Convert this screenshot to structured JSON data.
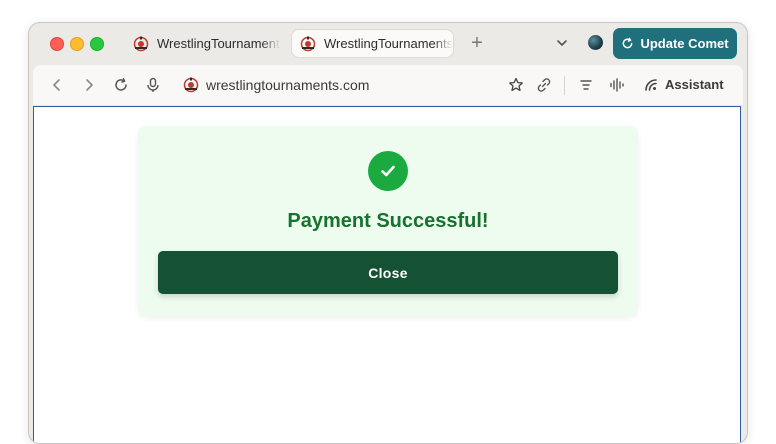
{
  "browser": {
    "tabs": [
      {
        "title": "WrestlingTournaments",
        "active": false,
        "icon": "wrestling-logo-icon"
      },
      {
        "title": "WrestlingTournaments",
        "active": true,
        "icon": "wrestling-logo-icon"
      }
    ],
    "new_tab_label": "+",
    "update_button_label": "Update Comet",
    "url": "wrestlingtournaments.com",
    "assistant_label": "Assistant"
  },
  "page": {
    "status_title": "Payment Successful!",
    "close_label": "Close"
  },
  "colors": {
    "accent": "#1f6f7c",
    "success_green": "#1aaa3f",
    "title_green": "#17722f",
    "button_dark_green": "#145233",
    "card_bg": "#edfcef"
  }
}
